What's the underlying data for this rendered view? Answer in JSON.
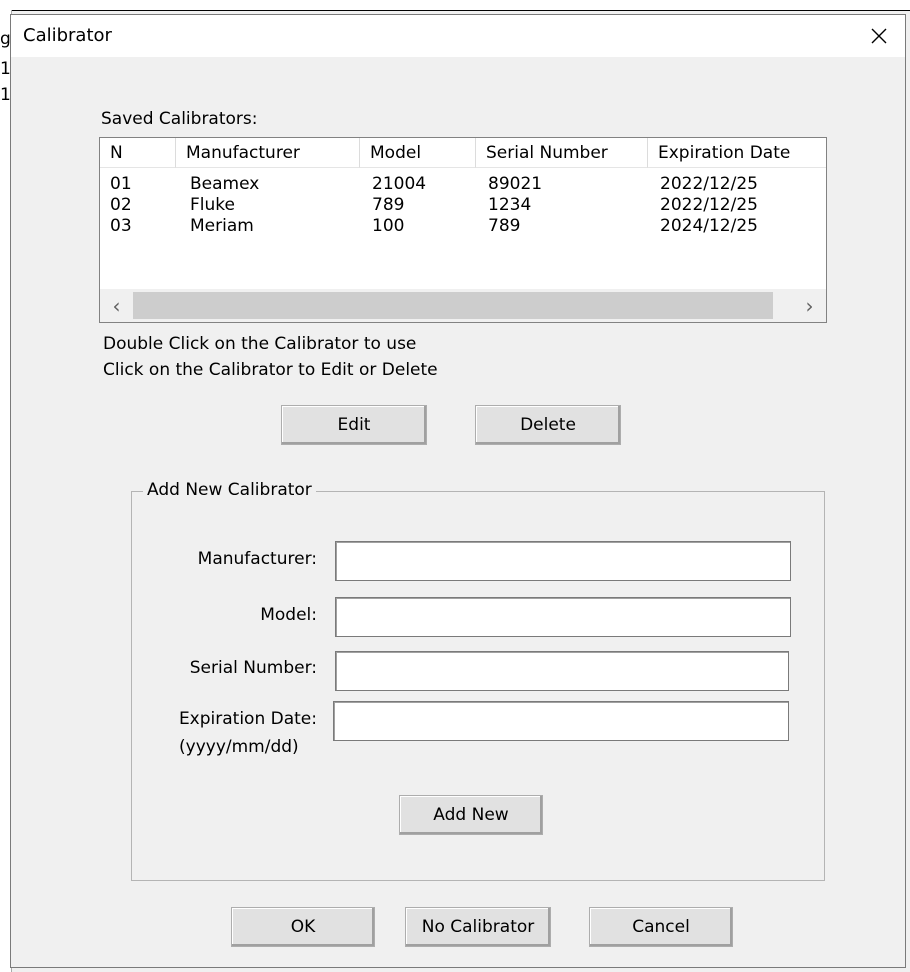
{
  "background": {
    "fragments": [
      "g",
      "1",
      "1"
    ]
  },
  "window": {
    "title": "Calibrator",
    "close_icon": "close-icon"
  },
  "saved_list": {
    "label": "Saved Calibrators:",
    "columns": [
      "N",
      "Manufacturer",
      "Model",
      "Serial Number",
      "Expiration Date"
    ],
    "rows": [
      [
        "01",
        "Beamex",
        "21004",
        "89021",
        "2022/12/25"
      ],
      [
        "02",
        "Fluke",
        "789",
        "1234",
        "2022/12/25"
      ],
      [
        "03",
        "Meriam",
        "100",
        "789",
        "2024/12/25"
      ]
    ],
    "scroll_left": "‹",
    "scroll_right": "›"
  },
  "hints": {
    "line1": "Double Click on the Calibrator to use",
    "line2": "Click on the Calibrator to Edit or Delete"
  },
  "actions": {
    "edit_label": "Edit",
    "delete_label": "Delete"
  },
  "add_group": {
    "title": "Add New Calibrator",
    "manufacturer_label": "Manufacturer:",
    "manufacturer_value": "",
    "model_label": "Model:",
    "model_value": "",
    "serial_label": "Serial Number:",
    "serial_value": "",
    "expiration_label": "Expiration Date:",
    "expiration_hint": "(yyyy/mm/dd)",
    "expiration_value": "",
    "add_label": "Add New"
  },
  "footer": {
    "ok_label": "OK",
    "no_calibrator_label": "No Calibrator",
    "cancel_label": "Cancel"
  }
}
